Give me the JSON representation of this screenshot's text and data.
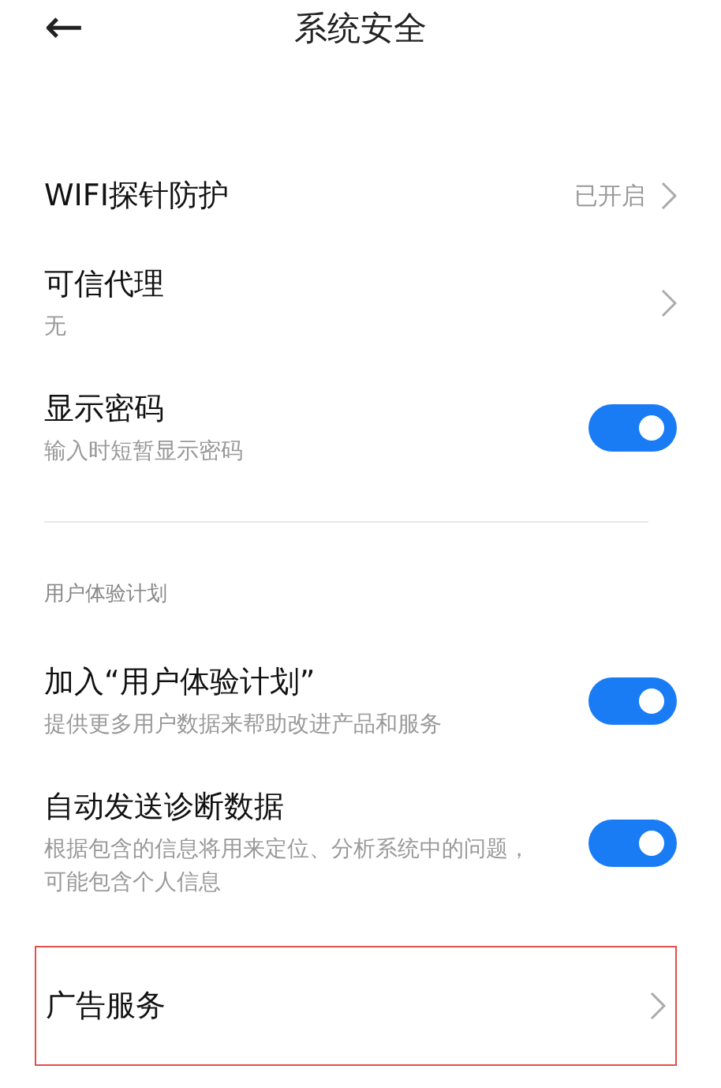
{
  "header": {
    "back": "←",
    "title": "系统安全"
  },
  "items": [
    {
      "kind": "link",
      "title": "WIFI探针防护",
      "value": "已开启"
    },
    {
      "kind": "link",
      "title": "可信代理",
      "subtitle": "无"
    },
    {
      "kind": "toggle",
      "title": "显示密码",
      "subtitle": "输入时短暂显示密码",
      "on": true
    },
    {
      "kind": "section",
      "title": "用户体验计划"
    },
    {
      "kind": "toggle",
      "title": "加入“用户体验计划”",
      "subtitle": "提供更多用户数据来帮助改进产品和服务",
      "on": true
    },
    {
      "kind": "toggle",
      "title": "自动发送诊断数据",
      "subtitle": "根据包含的信息将用来定位、分析系统中的问题，可能包含个人信息",
      "on": true
    },
    {
      "kind": "link",
      "title": "广告服务",
      "highlighted": true
    }
  ]
}
